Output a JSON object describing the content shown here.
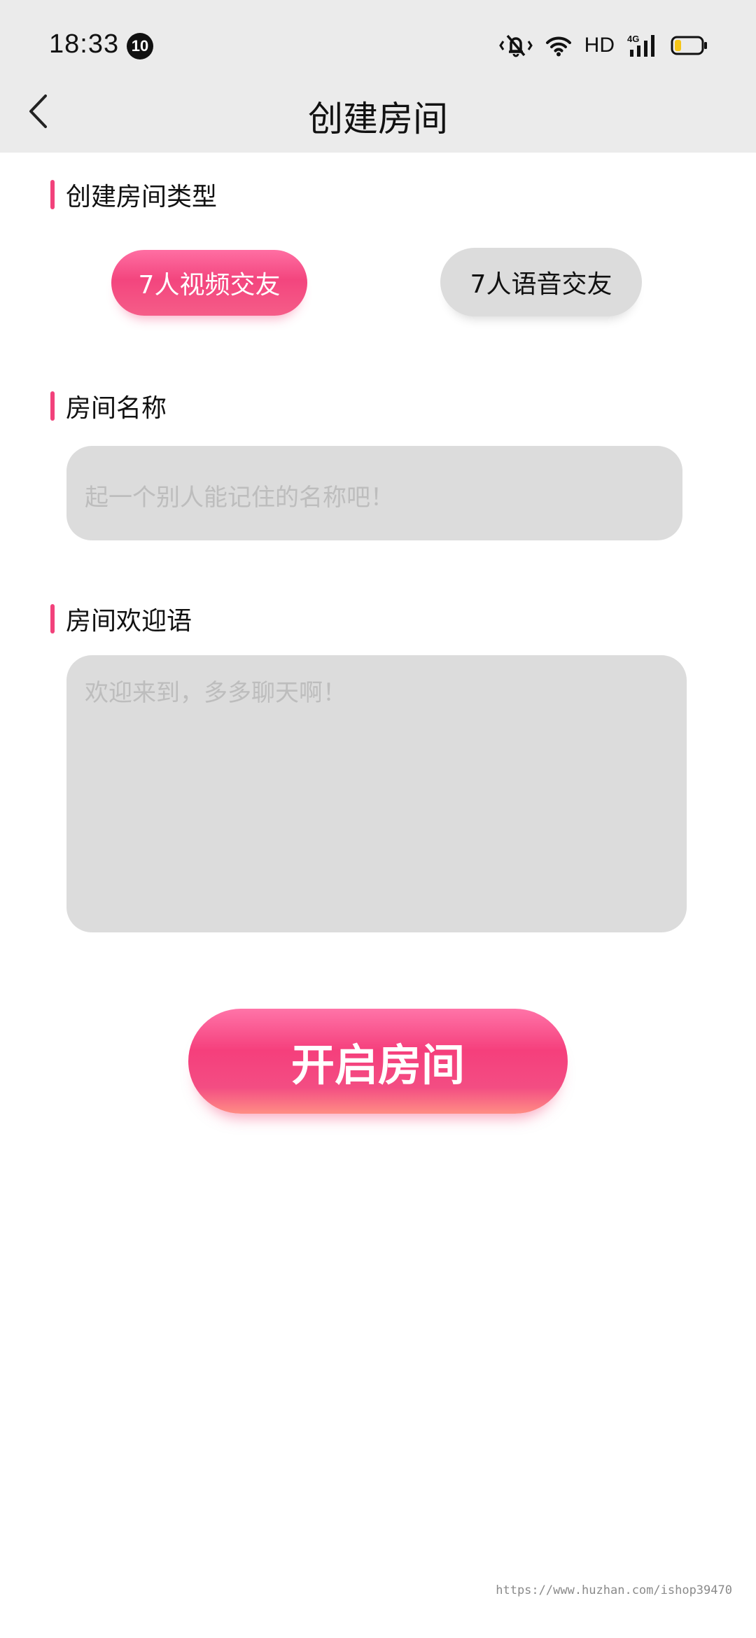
{
  "status_bar": {
    "time": "18:33",
    "notification_count": "10",
    "network_label": "HD",
    "icons": [
      "mute-vibrate-icon",
      "wifi-icon",
      "signal-4g-icon",
      "battery-icon"
    ],
    "battery_level": 0.25
  },
  "header": {
    "back_icon": "chevron-left-icon",
    "title": "创建房间"
  },
  "room_type": {
    "label": "创建房间类型",
    "options": [
      {
        "label": "7人视频交友",
        "selected": true
      },
      {
        "label": "7人语音交友",
        "selected": false
      }
    ]
  },
  "room_name": {
    "label": "房间名称",
    "value": "",
    "placeholder": "起一个别人能记住的名称吧！"
  },
  "room_welcome": {
    "label": "房间欢迎语",
    "value": "",
    "placeholder": "欢迎来到，多多聊天啊！"
  },
  "start_button": {
    "label": "开启房间"
  },
  "watermark": "https://www.huzhan.com/ishop39470",
  "colors": {
    "accent": "#f2427b",
    "topbar": "#ebebeb",
    "field": "#dcdcdc",
    "placeholder": "#bdbdbd"
  }
}
